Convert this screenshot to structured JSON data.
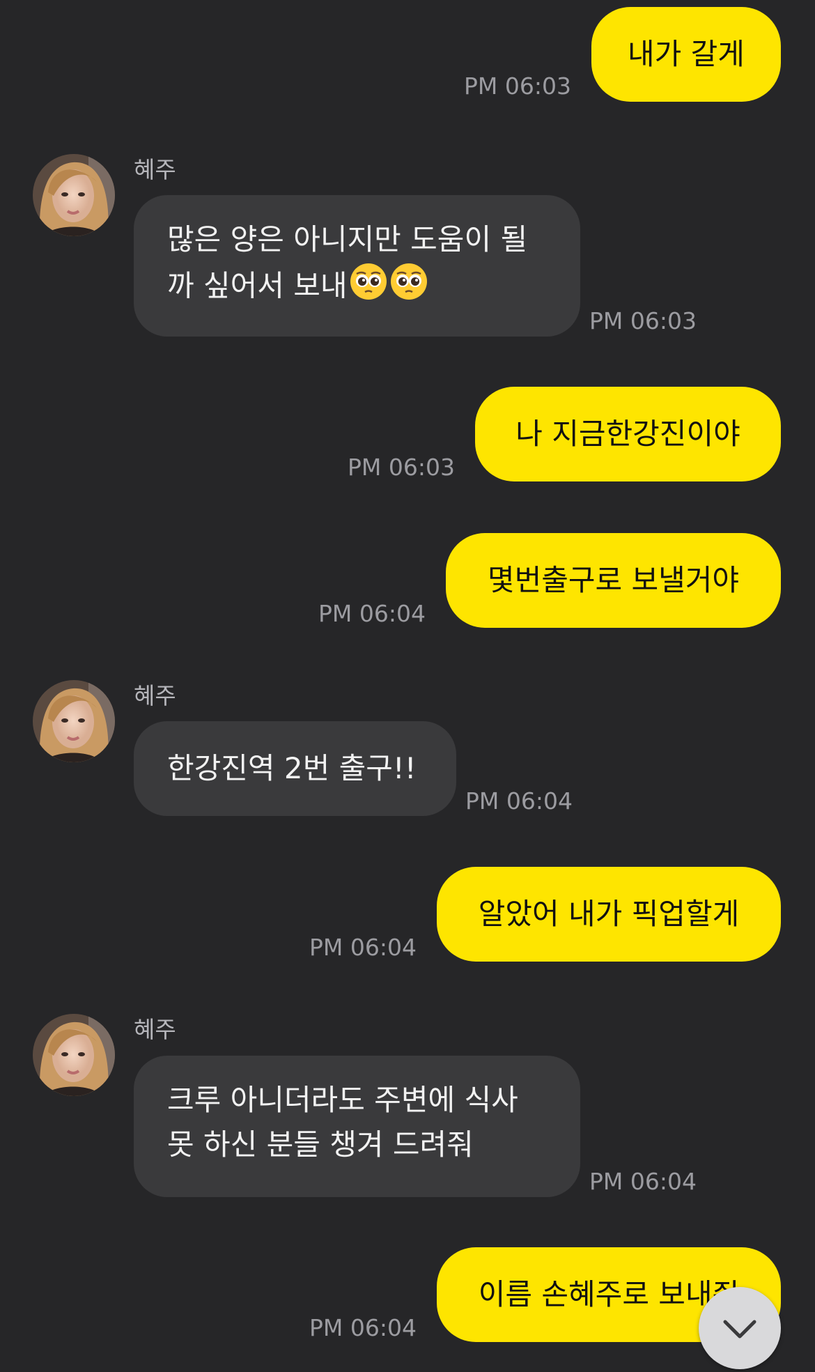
{
  "chat": {
    "sender_name": "혜주",
    "messages": [
      {
        "from": "me",
        "text": "내가 갈게",
        "time": "PM 06:03"
      },
      {
        "from": "other",
        "sender": "혜주",
        "lines": [
          "많은 양은 아니지만 도움이 될",
          "까 싶어서 보내"
        ],
        "emoji": "pleading-face-emoji x2",
        "time": "PM 06:03"
      },
      {
        "from": "me",
        "text": "나 지금한강진이야",
        "time": "PM 06:03"
      },
      {
        "from": "me",
        "text": "몇번출구로 보낼거야",
        "time": "PM 06:04"
      },
      {
        "from": "other",
        "sender": "혜주",
        "text": "한강진역 2번 출구!!",
        "time": "PM 06:04"
      },
      {
        "from": "me",
        "text": "알았어 내가 픽업할게",
        "time": "PM 06:04"
      },
      {
        "from": "other",
        "sender": "혜주",
        "lines": [
          "크루 아니더라도 주변에 식사",
          "못 하신 분들 챙겨 드려줘"
        ],
        "time": "PM 06:04"
      },
      {
        "from": "me",
        "text": "이름 손혜주로 보내줘",
        "time": "PM 06:04"
      }
    ]
  },
  "colors": {
    "background": "#262628",
    "my_bubble": "#FEE500",
    "other_bubble": "#3A3A3C",
    "time_text": "#9C9CA1"
  },
  "icons": {
    "scroll_down": "chevron-down-icon"
  }
}
